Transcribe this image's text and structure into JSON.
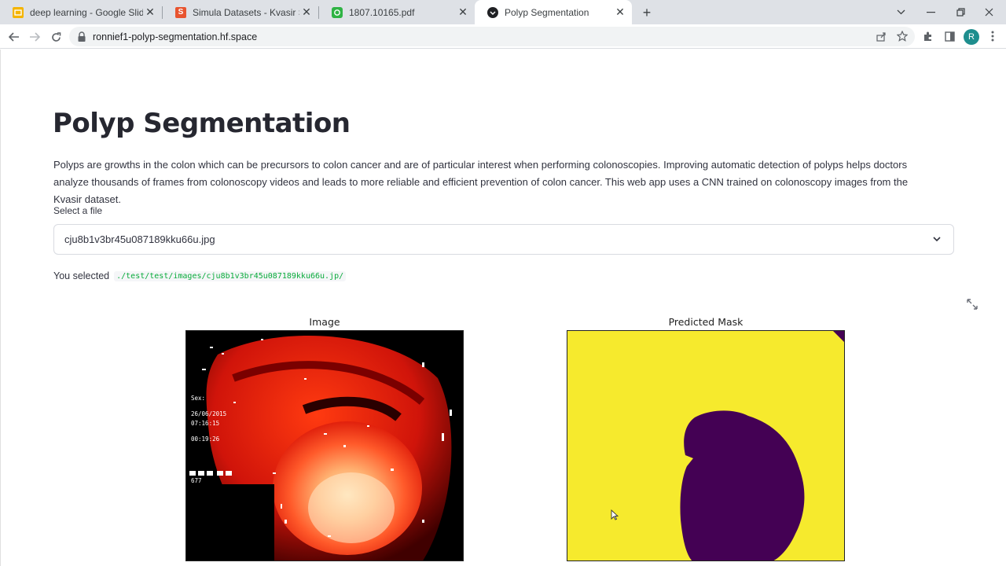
{
  "browser": {
    "tabs": [
      {
        "label": "deep learning - Google Slides",
        "icon": "google-slides-icon",
        "color": "#f4b400"
      },
      {
        "label": "Simula Datasets - Kvasir SEG",
        "icon": "simula-s-icon",
        "color": "#e8542f"
      },
      {
        "label": "1807.10165.pdf",
        "icon": "pdf-reader-icon",
        "color": "#2fb344"
      },
      {
        "label": "Polyp Segmentation",
        "icon": "huggingface-icon",
        "color": "#202124",
        "active": true
      }
    ],
    "address_bar": {
      "url": "ronnief1-polyp-segmentation.hf.space"
    },
    "profile_initial": "R"
  },
  "app": {
    "title": "Polyp Segmentation",
    "description": "Polyps are growths in the colon which can be precursors to colon cancer and are of particular interest when performing colonoscopies. Improving automatic detection of polyps helps doctors analyze thousands of frames from colonoscopy videos and leads to more reliable and efficient prevention of colon cancer. This web app uses a CNN trained on colonoscopy images from the Kvasir dataset.",
    "file_select": {
      "label": "Select a file",
      "value": "cju8b1v3br45u087189kku66u.jpg"
    },
    "selected": {
      "prefix": "You selected",
      "path": "./test/test/images/cju8b1v3br45u087189kku66u.jp/"
    },
    "figures": {
      "image_title": "Image",
      "mask_title": "Predicted Mask",
      "endoscope_overlay": {
        "label": "Sex:",
        "date": "26/06/2015",
        "time": "07:16:15",
        "elapsed": "00:19:26",
        "code": "677"
      },
      "mask_colors": {
        "background": "#f6ea2d",
        "polyp": "#440154"
      }
    }
  }
}
